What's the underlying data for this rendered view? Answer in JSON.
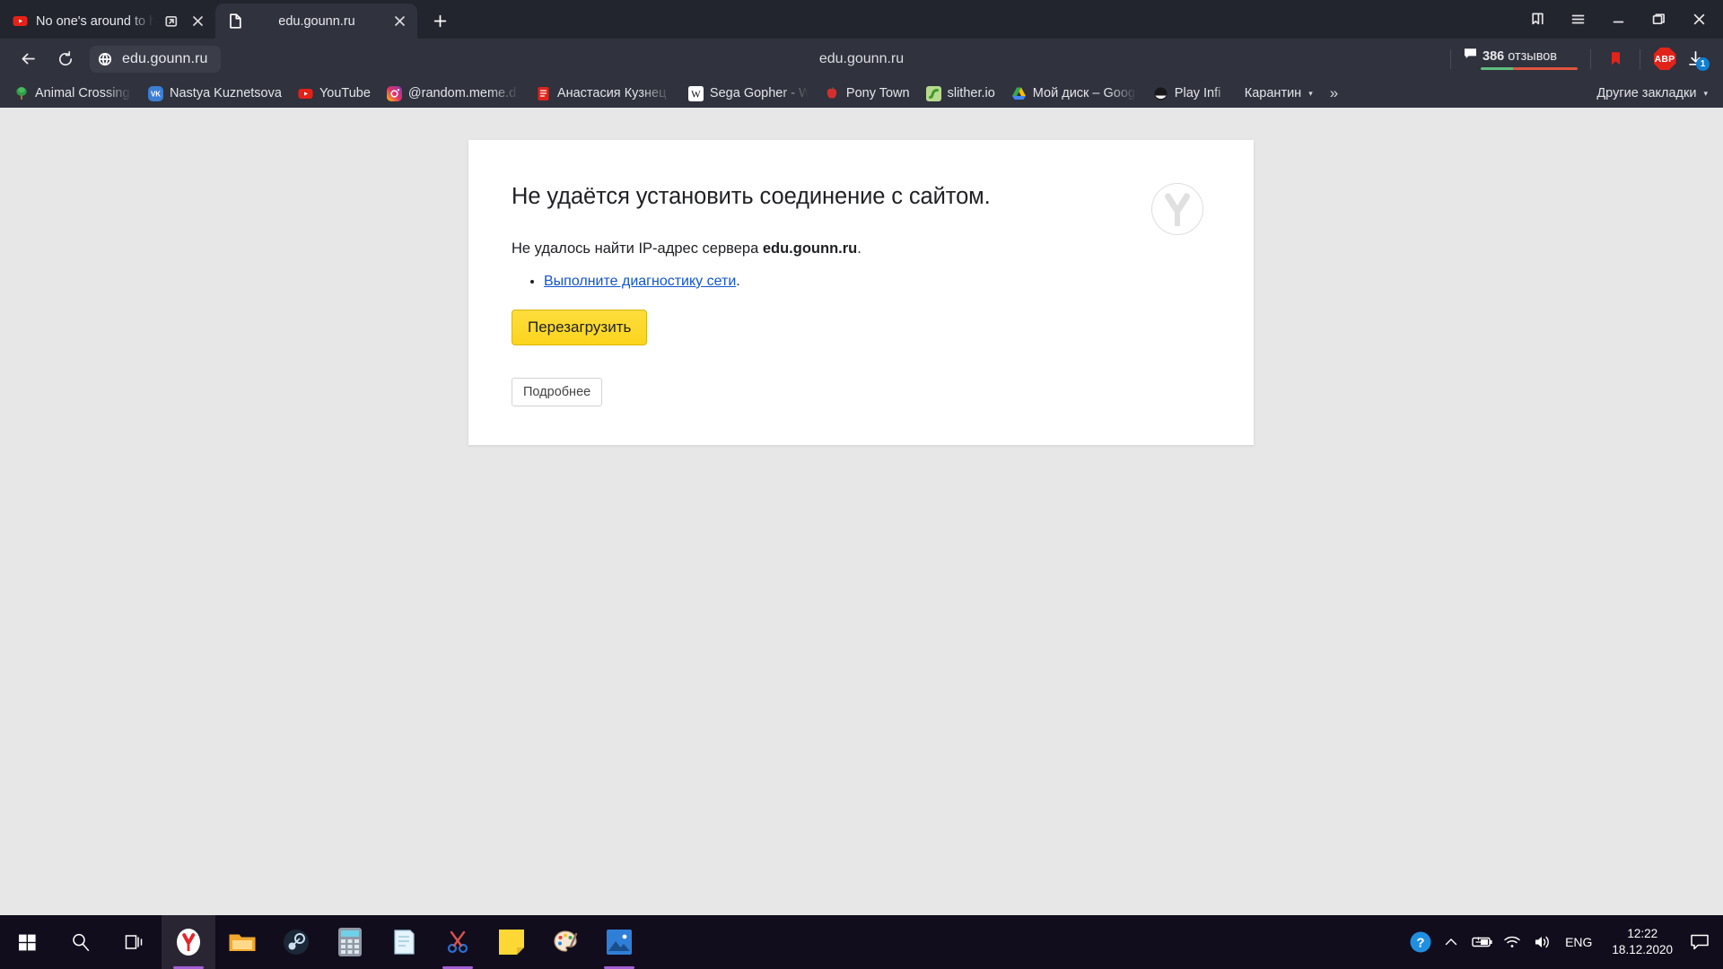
{
  "window": {
    "controls": [
      {
        "name": "collections-icon",
        "label": "Коллекции"
      },
      {
        "name": "menu-icon",
        "label": "Меню"
      },
      {
        "name": "minimize-icon",
        "label": "Свернуть"
      },
      {
        "name": "maximize-icon",
        "label": "Развернуть"
      },
      {
        "name": "close-icon",
        "label": "Закрыть"
      }
    ]
  },
  "tabs": [
    {
      "title": "No one's around to h",
      "favicon": "youtube-icon",
      "active": false
    },
    {
      "title": "edu.gounn.ru",
      "favicon": "page-icon",
      "active": true
    }
  ],
  "new_tab_label": "+",
  "toolbar": {
    "back_label": "Назад",
    "reload_label": "Обновить",
    "omnibox_url": "edu.gounn.ru",
    "center_url": "edu.gounn.ru",
    "reviews_count": "386",
    "reviews_word": "отзывов",
    "reviews_positive_pct": 33,
    "reviews_positive_color": "#5fbf7f",
    "reviews_negative_color": "#e0553f",
    "bookmark_flag_color": "#e2231a",
    "abp_label": "ABP",
    "abp_color": "#e2231a",
    "downloads_badge": "1",
    "downloads_badge_color": "#0f7fd4"
  },
  "bookmarks": {
    "items": [
      {
        "label": "Animal Crossing W",
        "icon": "tree-icon"
      },
      {
        "label": "Nastya Kuznetsova",
        "icon": "vk-icon"
      },
      {
        "label": "YouTube",
        "icon": "youtube-icon"
      },
      {
        "label": "@random.meme.d",
        "icon": "instagram-icon"
      },
      {
        "label": "Анастасия Кузнец",
        "icon": "document-red-icon"
      },
      {
        "label": "Sega Gopher - Wik",
        "icon": "wikipedia-icon"
      },
      {
        "label": "Pony Town",
        "icon": "apple-icon"
      },
      {
        "label": "slither.io",
        "icon": "snake-icon"
      },
      {
        "label": "Мой диск – Googl",
        "icon": "google-drive-icon"
      },
      {
        "label": "Play Infi",
        "icon": "dark-circle-icon"
      },
      {
        "label": "Карантин",
        "icon": "folder-icon",
        "caret": "▾"
      }
    ],
    "overflow_label": "»",
    "other_label": "Другие закладки",
    "other_caret": "▾"
  },
  "page": {
    "title": "Не удаётся установить соединение с сайтом.",
    "subtitle_prefix": "Не удалось найти IP-адрес сервера ",
    "subtitle_host": "edu.gounn.ru",
    "subtitle_suffix": ".",
    "bullet_link": "Выполните диагностику сети",
    "bullet_suffix": ".",
    "reload_button": "Перезагрузить",
    "details_button": "Подробнее",
    "brand_logo": "yandex-y-logo",
    "background_color": "#e7e7e7",
    "card_color": "#ffffff",
    "reload_button_color": "#fbd51c",
    "link_color": "#1155cc"
  },
  "taskbar": {
    "system": [
      {
        "name": "start-button",
        "label": "Пуск"
      },
      {
        "name": "search-button",
        "label": "Поиск"
      },
      {
        "name": "task-view-button",
        "label": "Представление задач"
      }
    ],
    "apps": [
      {
        "name": "yandex-browser",
        "label": "Яндекс.Браузер",
        "active": true
      },
      {
        "name": "file-explorer",
        "label": "Проводник",
        "active": false
      },
      {
        "name": "steam",
        "label": "Steam",
        "active": false
      },
      {
        "name": "calculator",
        "label": "Калькулятор",
        "active": false
      },
      {
        "name": "notepad",
        "label": "Блокнот",
        "active": false
      },
      {
        "name": "snipping-tool",
        "label": "Ножницы",
        "active": true
      },
      {
        "name": "sticky-notes",
        "label": "Записки",
        "active": false
      },
      {
        "name": "paint",
        "label": "Paint",
        "active": false
      },
      {
        "name": "photos",
        "label": "Фотографии",
        "active": true
      }
    ],
    "tray": {
      "help_label": "?",
      "language": "ENG",
      "time": "12:22",
      "date": "18.12.2020"
    }
  }
}
